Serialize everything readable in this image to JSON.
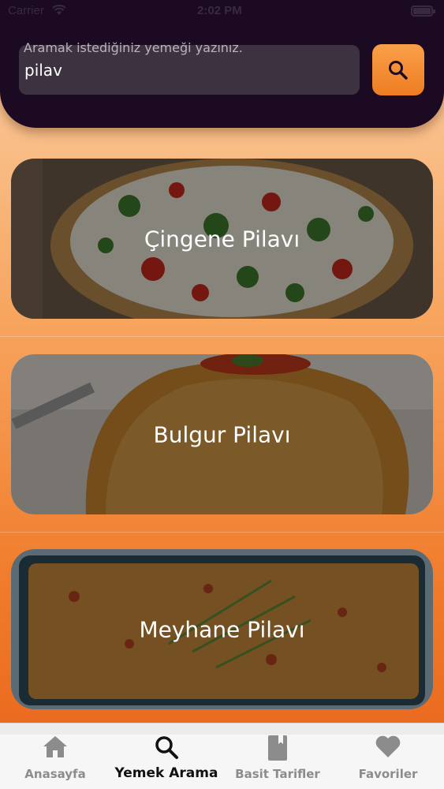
{
  "status": {
    "carrier": "Carrier",
    "time": "2:02 PM"
  },
  "search": {
    "placeholder": "Aramak istediğiniz yemeği yazınız.",
    "value": "pilav"
  },
  "results": [
    {
      "title": "Çingene Pilavı"
    },
    {
      "title": "Bulgur Pilavı"
    },
    {
      "title": "Meyhane Pilavı"
    }
  ],
  "tabs": [
    {
      "label": "Anasayfa",
      "icon": "home-icon"
    },
    {
      "label": "Yemek Arama",
      "icon": "search-icon",
      "active": true
    },
    {
      "label": "Basit Tarifler",
      "icon": "book-icon"
    },
    {
      "label": "Favoriler",
      "icon": "heart-icon"
    }
  ],
  "colors": {
    "header": "#1b0a22",
    "accent": "#f08a30",
    "search_box": "#3d3340"
  }
}
